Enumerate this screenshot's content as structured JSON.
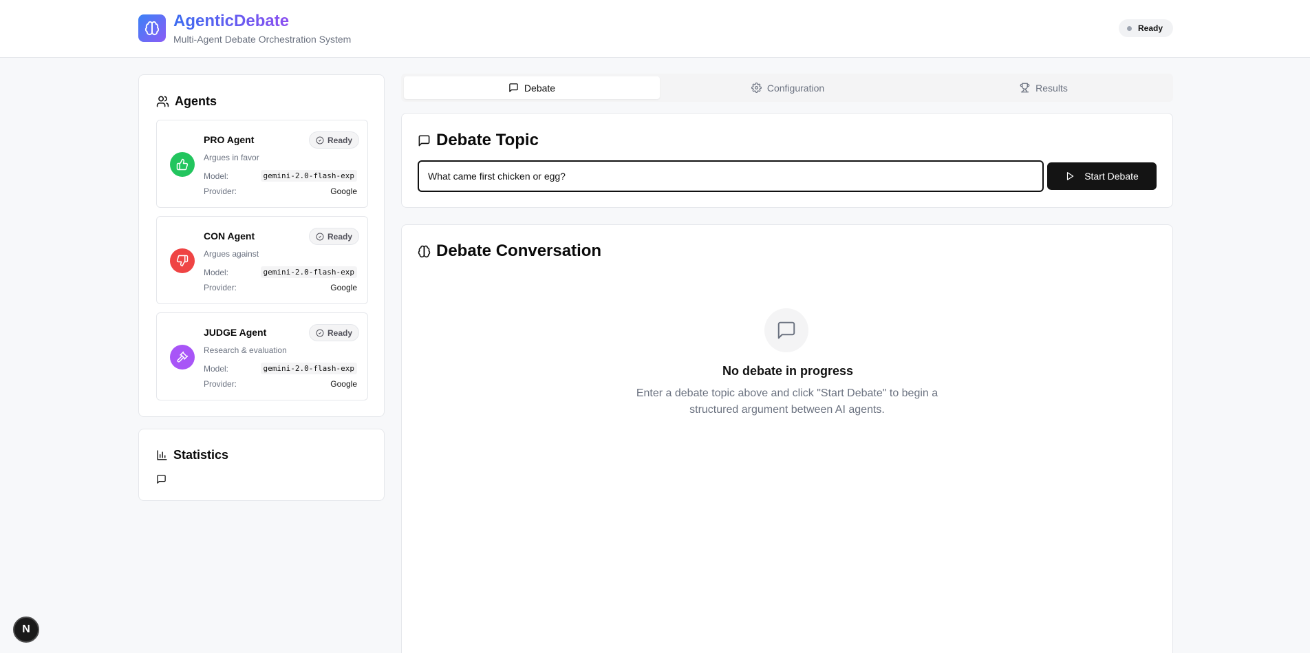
{
  "header": {
    "title": "AgenticDebate",
    "subtitle": "Multi-Agent Debate Orchestration System",
    "status": "Ready"
  },
  "sidebar": {
    "agents_title": "Agents",
    "model_label": "Model:",
    "provider_label": "Provider:",
    "agents": [
      {
        "name": "PRO Agent",
        "desc": "Argues in favor",
        "status": "Ready",
        "model": "gemini-2.0-flash-exp",
        "provider": "Google",
        "color": "#22c55e",
        "icon": "thumbs-up-icon"
      },
      {
        "name": "CON Agent",
        "desc": "Argues against",
        "status": "Ready",
        "model": "gemini-2.0-flash-exp",
        "provider": "Google",
        "color": "#ef4444",
        "icon": "thumbs-down-icon"
      },
      {
        "name": "JUDGE Agent",
        "desc": "Research & evaluation",
        "status": "Ready",
        "model": "gemini-2.0-flash-exp",
        "provider": "Google",
        "color": "#a855f7",
        "icon": "gavel-icon"
      }
    ],
    "statistics_title": "Statistics"
  },
  "tabs": [
    {
      "label": "Debate",
      "icon": "message-icon",
      "active": true
    },
    {
      "label": "Configuration",
      "icon": "gear-icon",
      "active": false
    },
    {
      "label": "Results",
      "icon": "trophy-icon",
      "active": false
    }
  ],
  "topic": {
    "title": "Debate Topic",
    "value": "What came first chicken or egg?",
    "start_label": "Start Debate"
  },
  "conversation": {
    "title": "Debate Conversation",
    "empty_title": "No debate in progress",
    "empty_desc": "Enter a debate topic above and click \"Start Debate\" to begin a structured argument between AI agents."
  },
  "dev_badge": "N"
}
